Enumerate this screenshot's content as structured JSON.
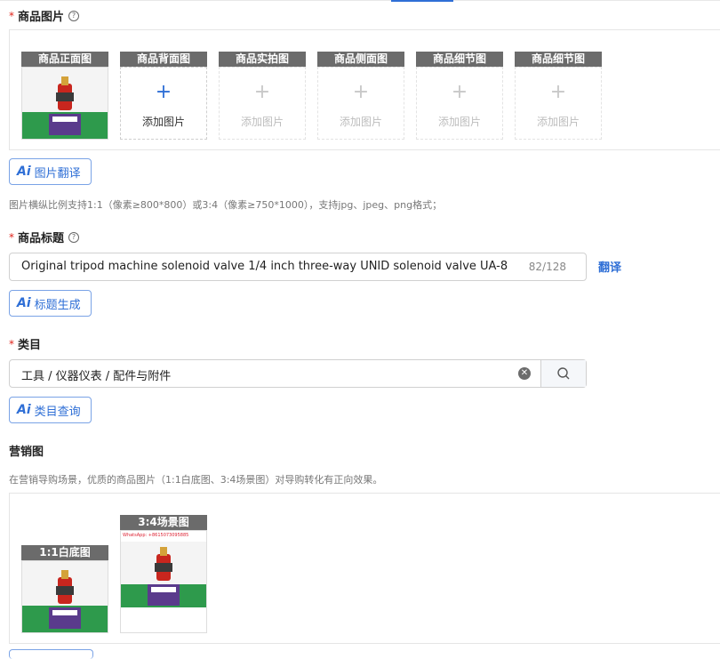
{
  "product_images": {
    "label": "商品图片",
    "slots": [
      {
        "label": "商品正面图",
        "filled": true
      },
      {
        "label": "商品背面图",
        "filled": false,
        "add": "添加图片",
        "enabled": true
      },
      {
        "label": "商品实拍图",
        "filled": false,
        "add": "添加图片",
        "enabled": false
      },
      {
        "label": "商品侧面图",
        "filled": false,
        "add": "添加图片",
        "enabled": false
      },
      {
        "label": "商品细节图",
        "filled": false,
        "add": "添加图片",
        "enabled": false
      },
      {
        "label": "商品细节图",
        "filled": false,
        "add": "添加图片",
        "enabled": false
      }
    ],
    "ai_button": "图片翻译",
    "hint": "图片横纵比例支持1:1（像素≥800*800）或3:4（像素≥750*1000），支持jpg、jpeg、png格式；"
  },
  "title_field": {
    "label": "商品标题",
    "value": "Original tripod machine solenoid valve 1/4 inch three-way UNID solenoid valve UA-8",
    "counter": "82/128",
    "translate": "翻译",
    "ai_button": "标题生成"
  },
  "category": {
    "label": "类目",
    "value": "工具 / 仪器仪表 / 配件与附件",
    "ai_button": "类目查询"
  },
  "marketing": {
    "label": "营销图",
    "hint": "在营销导购场景，优质的商品图片（1:1白底图、3:4场景图）对导购转化有正向效果。",
    "slots": [
      {
        "label": "1:1白底图"
      },
      {
        "label": "3:4场景图"
      }
    ],
    "scene_caption": "WhatsApp: +8615073095885"
  },
  "colors": {
    "accent": "#2f6fd6",
    "required": "#e0241b"
  }
}
